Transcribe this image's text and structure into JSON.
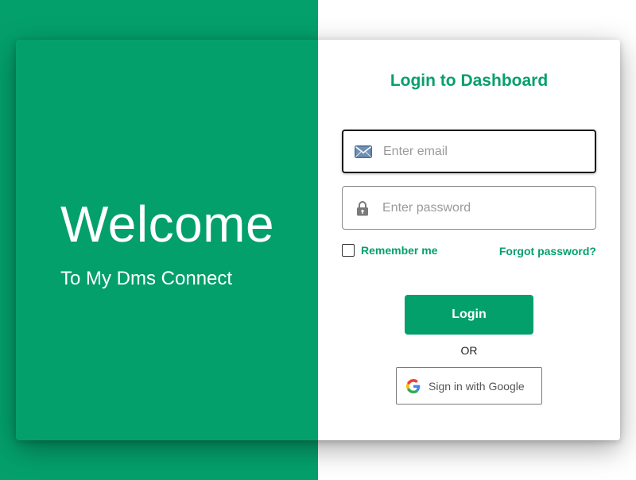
{
  "welcome": {
    "title": "Welcome",
    "subtitle": "To My Dms Connect"
  },
  "login": {
    "title": "Login to Dashboard",
    "email": {
      "placeholder": "Enter email",
      "value": "",
      "icon": "envelope-icon"
    },
    "password": {
      "placeholder": "Enter password",
      "value": "",
      "icon": "lock-icon"
    },
    "remember_label": "Remember me",
    "remember_checked": false,
    "forgot_label": "Forgot password?",
    "submit_label": "Login",
    "or_text": "OR",
    "google_label": "Sign in with Google",
    "google_icon": "google-icon"
  },
  "colors": {
    "accent": "#04a06b",
    "background_right": "#ffffff"
  }
}
